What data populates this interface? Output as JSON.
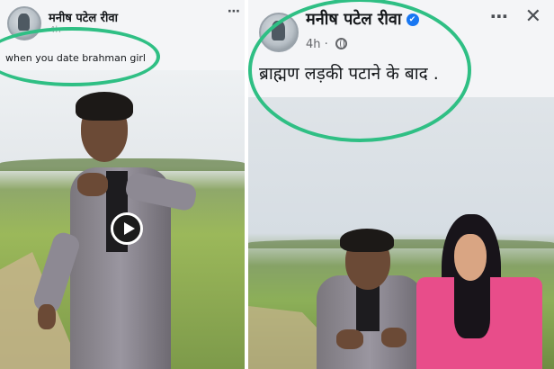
{
  "left_post": {
    "author": "मनीष पटेल रीवा",
    "meta": "4h",
    "caption": "when you date brahman girl",
    "more_icon": "⋯",
    "avatar_icon": "profile-avatar",
    "play_icon": "play-icon"
  },
  "right_post": {
    "author": "मनीष पटेल रीवा",
    "verified_mark": "✔",
    "time": "4h",
    "meta_sep": "·",
    "caption": "ब्राह्मण लड़की पटाने के बाद .",
    "more_icon": "⋯",
    "close_icon": "✕",
    "avatar_icon": "profile-avatar",
    "globe_icon": "globe-icon"
  },
  "colors": {
    "highlight": "#2fbf84",
    "verified": "#1877f2",
    "header_bg": "#f4f5f7",
    "pink_top": "#e84d8a"
  }
}
